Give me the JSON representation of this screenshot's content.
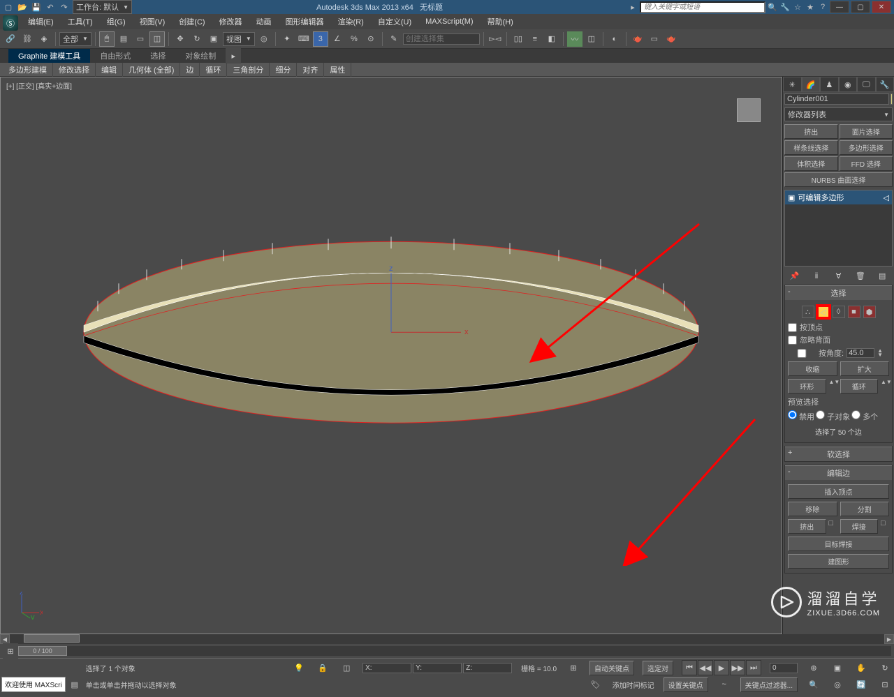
{
  "title": {
    "app": "Autodesk 3ds Max  2013 x64",
    "file": "无标题",
    "workspace_label": "工作台: 默认",
    "search_placeholder": "键入关键字或短语"
  },
  "menu": {
    "edit": "编辑(E)",
    "tools": "工具(T)",
    "group": "组(G)",
    "views": "视图(V)",
    "create": "创建(C)",
    "modifiers": "修改器",
    "animation": "动画",
    "graph": "图形编辑器",
    "rendering": "渲染(R)",
    "customize": "自定义(U)",
    "maxscript": "MAXScript(M)",
    "help": "帮助(H)"
  },
  "toolbar": {
    "filter": "全部",
    "coord": "视图",
    "named_set": "创建选择集"
  },
  "ribbon": {
    "tabs": {
      "graphite": "Graphite 建模工具",
      "freeform": "自由形式",
      "selection": "选择",
      "paint": "对象绘制"
    },
    "sub": {
      "poly_model": "多边形建模",
      "mod_select": "修改选择",
      "edit": "编辑",
      "geom_all": "几何体 (全部)",
      "edge": "边",
      "loop": "循环",
      "tri": "三角剖分",
      "subdiv": "细分",
      "align": "对齐",
      "properties": "属性"
    }
  },
  "viewport": {
    "label": "[+] [正交] [真实+边面]"
  },
  "panel": {
    "object_name": "Cylinder001",
    "modifier_placeholder": "修改器列表",
    "mod_btns": {
      "extrude": "挤出",
      "face_sel": "面片选择",
      "spline_sel": "样条线选择",
      "poly_sel": "多边形选择",
      "vol_sel": "体积选择",
      "ffd_sel": "FFD 选择",
      "nurbs": "NURBS 曲面选择"
    },
    "stack_item": "可编辑多边形",
    "selection": {
      "title": "选择",
      "by_vertex": "按顶点",
      "ignore_back": "忽略背面",
      "by_angle": "按角度:",
      "angle_value": "45.0",
      "shrink": "收缩",
      "grow": "扩大",
      "ring": "环形",
      "loop": "循环",
      "preview_label": "预览选择",
      "r_off": "禁用",
      "r_sub": "子对象",
      "r_multi": "多个",
      "info": "选择了 50 个边"
    },
    "soft_sel": "软选择",
    "edit_edges": {
      "title": "编辑边",
      "insert_vertex": "插入顶点",
      "remove": "移除",
      "split": "分割",
      "extrude": "挤出",
      "weld": "焊接",
      "target_weld": "目标焊接",
      "create_shape": "建图形"
    }
  },
  "timeline": {
    "frame": "0 / 100"
  },
  "status": {
    "welcome": "欢迎使用 MAXScri",
    "line1": "选择了 1 个对象",
    "line2": "单击或单击并拖动以选择对象",
    "grid": "栅格 = 10.0",
    "auto_key": "自动关键点",
    "set_key": "设置关键点",
    "selected": "选定对",
    "key_filter": "关键点过滤器...",
    "add_time": "添加时间标记"
  },
  "watermark": {
    "cn": "溜溜自学",
    "en": "ZIXUE.3D66.COM"
  }
}
